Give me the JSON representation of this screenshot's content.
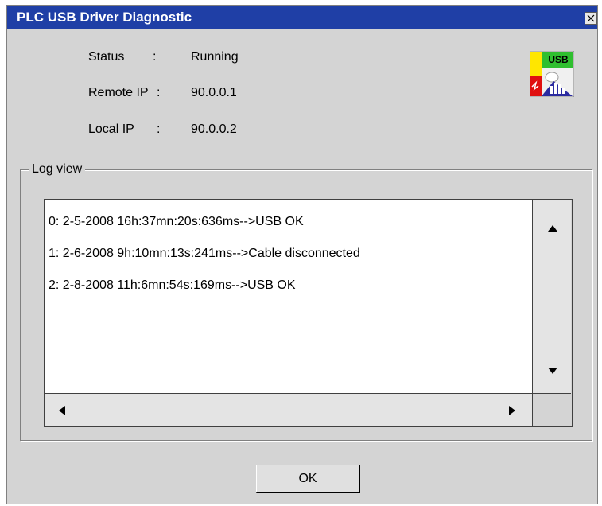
{
  "window": {
    "title": "PLC  USB Driver Diagnostic"
  },
  "status_rows": [
    {
      "label": "Status",
      "sep": ":",
      "value": "Running"
    },
    {
      "label": "Remote IP",
      "sep": ":",
      "value": "90.0.0.1"
    },
    {
      "label": "Local  IP",
      "sep": ":",
      "value": "90.0.0.2"
    }
  ],
  "icon": {
    "name": "usb-diagnostic-icon",
    "text": "USB"
  },
  "log": {
    "title": "Log view",
    "entries": [
      "0: 2-5-2008  16h:37mn:20s:636ms-->USB OK",
      "1: 2-6-2008  9h:10mn:13s:241ms-->Cable disconnected",
      "2: 2-8-2008  11h:6mn:54s:169ms-->USB OK"
    ]
  },
  "buttons": {
    "ok": "OK"
  },
  "colors": {
    "titlebar": "#1f3fa6",
    "dialog_bg": "#d4d4d4"
  }
}
